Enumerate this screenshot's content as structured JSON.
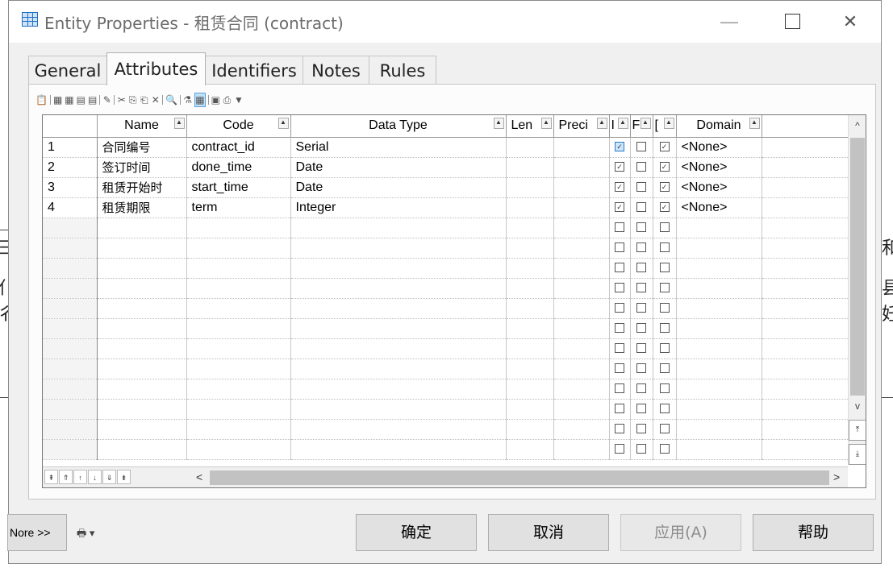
{
  "background": {
    "left_fragments": [
      "三",
      "亻",
      "彳"
    ],
    "right_fragments": [
      "和",
      "县",
      "妊"
    ]
  },
  "window": {
    "title": "Entity Properties - 租赁合同 (contract)",
    "minimize_glyph": "—",
    "close_glyph": "✕"
  },
  "tabs": [
    {
      "label": "General"
    },
    {
      "label": "Attributes",
      "active": true
    },
    {
      "label": "Identifiers"
    },
    {
      "label": "Notes"
    },
    {
      "label": "Rules"
    }
  ],
  "toolbar": {
    "glyphs": [
      "📋",
      "▦",
      "▦",
      "▤",
      "▤",
      "✎",
      "✂",
      "⎘",
      "⎗",
      "✕",
      "🔍",
      "⚗",
      "▦",
      "▣",
      "⎙",
      "▼"
    ]
  },
  "grid": {
    "columns": [
      {
        "label": ""
      },
      {
        "label": "Name"
      },
      {
        "label": "Code"
      },
      {
        "label": "Data Type"
      },
      {
        "label": "Len"
      },
      {
        "label": "Preci"
      },
      {
        "label": "I"
      },
      {
        "label": "F"
      },
      {
        "label": "["
      },
      {
        "label": "Domain"
      },
      {
        "label": ""
      }
    ],
    "rows": [
      {
        "num": "1",
        "name": "合同编号",
        "code": "contract_id",
        "type": "Serial",
        "len": "",
        "prec": "",
        "m": true,
        "p": false,
        "d": true,
        "domain": "<None>",
        "selected_m": true
      },
      {
        "num": "2",
        "name": "签订时间",
        "code": "done_time",
        "type": "Date",
        "len": "",
        "prec": "",
        "m": true,
        "p": false,
        "d": true,
        "domain": "<None>"
      },
      {
        "num": "3",
        "name": "租赁开始时",
        "code": "start_time",
        "type": "Date",
        "len": "",
        "prec": "",
        "m": true,
        "p": false,
        "d": true,
        "domain": "<None>"
      },
      {
        "num": "4",
        "name": "租赁期限",
        "code": "term",
        "type": "Integer",
        "len": "",
        "prec": "",
        "m": true,
        "p": false,
        "d": true,
        "domain": "<None>"
      }
    ],
    "empty_rows": 12,
    "scroll_up": "^",
    "scroll_down": "v",
    "scroll_left": "<",
    "scroll_right": ">",
    "nav_buttons": [
      "⇞",
      "⇑",
      "↑",
      "↓",
      "⇓",
      "⇟"
    ],
    "page_top": "⤒",
    "page_bottom": "⤓"
  },
  "footer": {
    "more_label": "Nore >>",
    "ok_label": "确定",
    "cancel_label": "取消",
    "apply_label": "应用(A)",
    "help_label": "帮助"
  }
}
